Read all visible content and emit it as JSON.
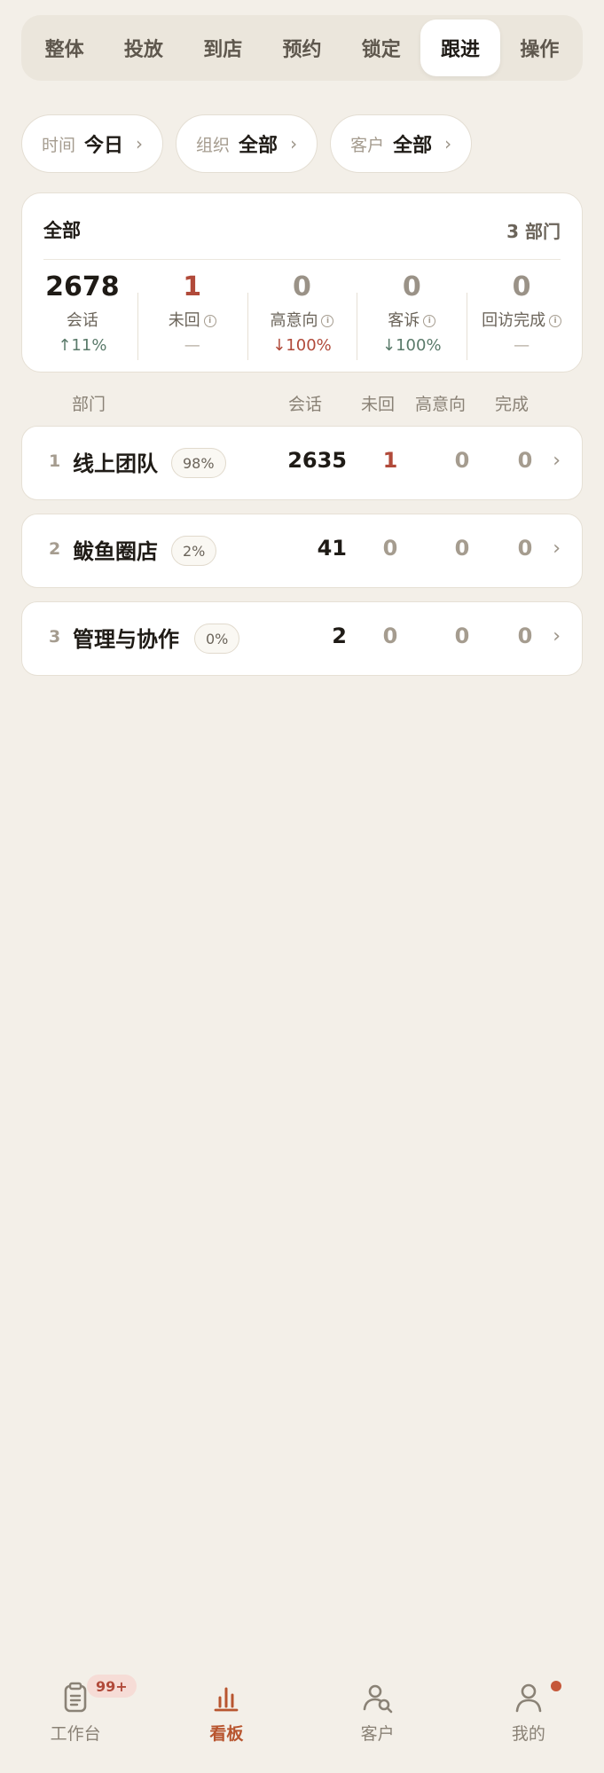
{
  "tabs": [
    {
      "label": "整体"
    },
    {
      "label": "投放"
    },
    {
      "label": "到店"
    },
    {
      "label": "预约"
    },
    {
      "label": "锁定"
    },
    {
      "label": "跟进",
      "active": true
    },
    {
      "label": "操作"
    }
  ],
  "filters": [
    {
      "key": "时间",
      "value": "今日"
    },
    {
      "key": "组织",
      "value": "全部"
    },
    {
      "key": "客户",
      "value": "全部"
    }
  ],
  "summary": {
    "title": "全部",
    "dept_count": "3 部门",
    "stats": [
      {
        "value": "2678",
        "label": "会话",
        "delta": "↑11%",
        "info": false
      },
      {
        "value": "1",
        "label": "未回",
        "delta": "—",
        "info": true
      },
      {
        "value": "0",
        "label": "高意向",
        "delta": "↓100%",
        "info": true
      },
      {
        "value": "0",
        "label": "客诉",
        "delta": "↓100%",
        "info": true
      },
      {
        "value": "0",
        "label": "回访完成",
        "delta": "—",
        "info": true
      }
    ]
  },
  "columns": {
    "dept": "部门",
    "session": "会话",
    "unreplied": "未回",
    "high_intent": "高意向",
    "done": "完成"
  },
  "rows": [
    {
      "index": "1",
      "name": "线上团队",
      "pct": "98%",
      "session": "2635",
      "unreplied": "1",
      "high_intent": "0",
      "done": "0"
    },
    {
      "index": "2",
      "name": "鲅鱼圈店",
      "pct": "2%",
      "session": "41",
      "unreplied": "0",
      "high_intent": "0",
      "done": "0"
    },
    {
      "index": "3",
      "name": "管理与协作",
      "pct": "0%",
      "session": "2",
      "unreplied": "0",
      "high_intent": "0",
      "done": "0"
    }
  ],
  "nav": [
    {
      "label": "工作台",
      "icon": "clipboard-icon",
      "badge": "99+"
    },
    {
      "label": "看板",
      "icon": "bar-chart-icon",
      "active": true
    },
    {
      "label": "客户",
      "icon": "customer-search-icon"
    },
    {
      "label": "我的",
      "icon": "person-icon",
      "dot": true
    }
  ],
  "colors": {
    "background": "#f3efe8",
    "accent": "#b8552f",
    "alert": "#b14a3a"
  }
}
